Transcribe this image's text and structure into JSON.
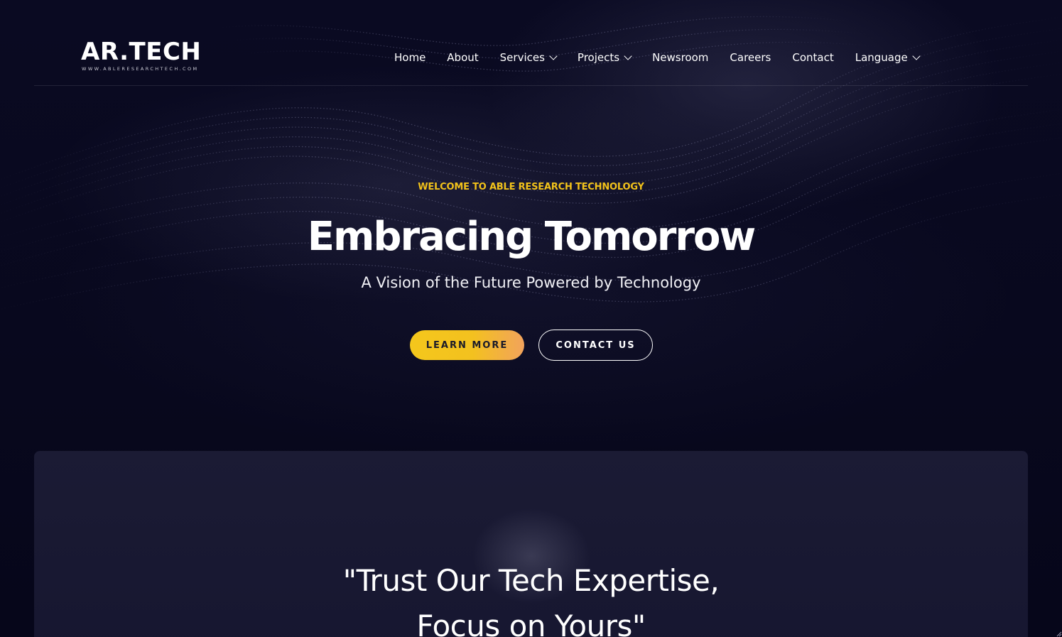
{
  "logo": {
    "main": "AR.TECH",
    "sub": "WWW.ABLERESEARCHTECH.COM"
  },
  "nav": {
    "items": [
      {
        "label": "Home",
        "dropdown": false
      },
      {
        "label": "About",
        "dropdown": false
      },
      {
        "label": "Services",
        "dropdown": true
      },
      {
        "label": "Projects",
        "dropdown": true
      },
      {
        "label": "Newsroom",
        "dropdown": false
      },
      {
        "label": "Careers",
        "dropdown": false
      },
      {
        "label": "Contact",
        "dropdown": false
      },
      {
        "label": "Language",
        "dropdown": true
      }
    ]
  },
  "hero": {
    "eyebrow": "WELCOME TO ABLE RESEARCH TECHNOLOGY",
    "title": "Embracing Tomorrow",
    "subtitle": "A Vision of the Future Powered by Technology",
    "primary_button": "LEARN MORE",
    "secondary_button": "CONTACT US"
  },
  "quote": {
    "line1": "\"Trust Our Tech Expertise,",
    "line2": "Focus on Yours\""
  },
  "colors": {
    "background": "#07071c",
    "accent": "#f2c21a",
    "card": "#1b1b34",
    "text": "#ffffff"
  }
}
